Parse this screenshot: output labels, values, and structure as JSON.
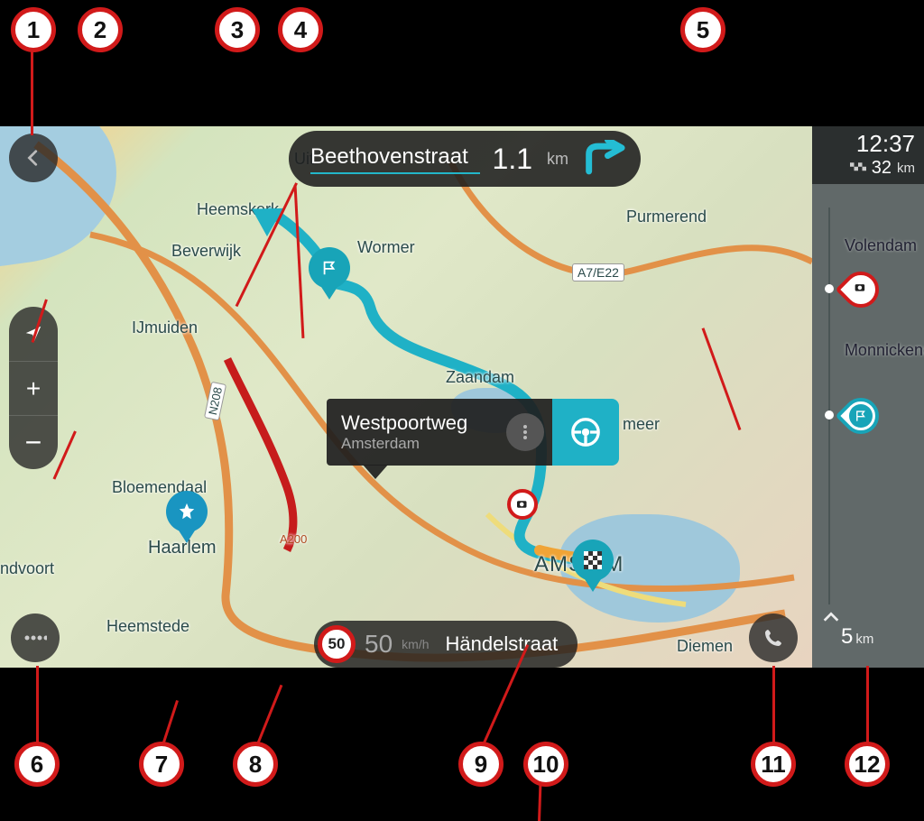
{
  "instruction": {
    "street": "Beethovenstraat",
    "distance_value": "1.1",
    "distance_unit": "km"
  },
  "popup": {
    "line1": "Westpoortweg",
    "line2": "Amsterdam"
  },
  "speed": {
    "limit": "50",
    "current": "50",
    "unit": "km/h",
    "current_street": "Händelstraat"
  },
  "routebar": {
    "arrival_time": "12:37",
    "remaining_value": "32",
    "remaining_unit": "km",
    "scale_value": "5",
    "scale_unit": "km",
    "city_a": "Volendam",
    "city_b": "Monnickendam"
  },
  "map_labels": {
    "heemskerk": "Heemskerk",
    "beverwijk": "Beverwijk",
    "ijmuiden": "IJmuiden",
    "bloemendaal": "Bloemendaal",
    "haarlem": "Haarlem",
    "heemstede": "Heemstede",
    "ndvoort": "ndvoort",
    "wormer": "Wormer",
    "purmerend": "Purmerend",
    "zaandam": "Zaandam",
    "amsterdam": "AMS        AM",
    "diemen": "Diemen",
    "uit": "Uit",
    "a7e22": "A7/E22",
    "n208": "N208",
    "a200": "A200",
    "meer": "meer"
  },
  "callouts": {
    "c1": "1",
    "c2": "2",
    "c3": "3",
    "c4": "4",
    "c5": "5",
    "c6": "6",
    "c7": "7",
    "c8": "8",
    "c9": "9",
    "c10": "10",
    "c11": "11",
    "c12": "12"
  }
}
